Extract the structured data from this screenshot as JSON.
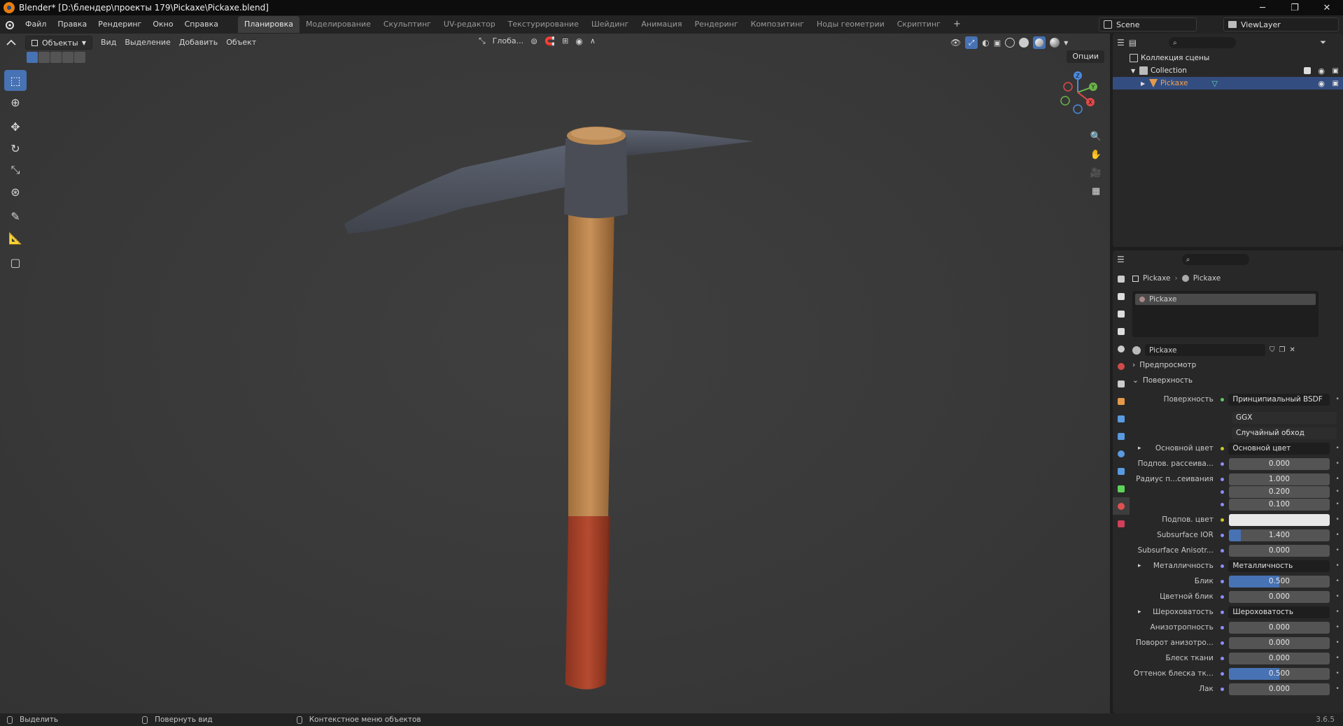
{
  "window": {
    "title": "Blender* [D:\\блендер\\проекты 179\\Pickaxe\\Pickaxe.blend]",
    "minimize": "─",
    "maximize": "❐",
    "close": "✕"
  },
  "menu": [
    "Файл",
    "Правка",
    "Рендеринг",
    "Окно",
    "Справка"
  ],
  "workspaces": [
    "Планировка",
    "Моделирование",
    "Скульптинг",
    "UV-редактор",
    "Текстурирование",
    "Шейдинг",
    "Анимация",
    "Рендеринг",
    "Композитинг",
    "Ноды геометрии",
    "Скриптинг"
  ],
  "active_workspace": "Планировка",
  "add_workspace": "+",
  "scene": {
    "name": "Scene",
    "view_layer": "ViewLayer"
  },
  "viewport": {
    "mode": "Объекты",
    "menus": [
      "Вид",
      "Выделение",
      "Добавить",
      "Объект"
    ],
    "transform_orientation": "Глоба...",
    "options": "Опции"
  },
  "outliner": {
    "root": "Коллекция сцены",
    "collection": "Collection",
    "object": "Pickaxe"
  },
  "properties": {
    "breadcrumb": [
      "Pickaxe",
      "Pickaxe"
    ],
    "material_slot": "Pickaxe",
    "material_name": "Pickaxe",
    "preview_label": "Предпросмотр",
    "surface_panel": "Поверхность",
    "rows": [
      {
        "label": "Поверхность",
        "type": "link",
        "value": "Принципиальный BSDF",
        "socket": "green"
      },
      {
        "label": "",
        "type": "dropdown",
        "value": "GGX"
      },
      {
        "label": "",
        "type": "dropdown",
        "value": "Случайный обход"
      },
      {
        "label": "Основной цвет",
        "type": "link",
        "value": "Основной цвет",
        "socket": "yellow",
        "expand": true
      },
      {
        "label": "Подпов. рассеива...",
        "type": "num",
        "value": "0.000",
        "fill": 0
      },
      {
        "label": "Радиус п...сеивания",
        "type": "num",
        "value": "1.000",
        "fill": 0
      },
      {
        "label": "",
        "type": "num",
        "value": "0.200",
        "fill": 0
      },
      {
        "label": "",
        "type": "num",
        "value": "0.100",
        "fill": 0
      },
      {
        "label": "Подпов. цвет",
        "type": "color",
        "value": "#e8e8e8",
        "socket": "yellow"
      },
      {
        "label": "Subsurface IOR",
        "type": "num",
        "value": "1.400",
        "fill": 0.12
      },
      {
        "label": "Subsurface Anisotr...",
        "type": "num",
        "value": "0.000",
        "fill": 0
      },
      {
        "label": "Металличность",
        "type": "link",
        "value": "Металличность",
        "expand": true
      },
      {
        "label": "Блик",
        "type": "num",
        "value": "0.500",
        "fill": 0.5
      },
      {
        "label": "Цветной блик",
        "type": "num",
        "value": "0.000",
        "fill": 0
      },
      {
        "label": "Шероховатость",
        "type": "link",
        "value": "Шероховатость",
        "expand": true
      },
      {
        "label": "Анизотропность",
        "type": "num",
        "value": "0.000",
        "fill": 0
      },
      {
        "label": "Поворот анизотро...",
        "type": "num",
        "value": "0.000",
        "fill": 0
      },
      {
        "label": "Блеск ткани",
        "type": "num",
        "value": "0.000",
        "fill": 0
      },
      {
        "label": "Оттенок блеска тк...",
        "type": "num",
        "value": "0.500",
        "fill": 0.5
      },
      {
        "label": "Лак",
        "type": "num",
        "value": "0.000",
        "fill": 0
      }
    ]
  },
  "statusbar": {
    "select": "Выделить",
    "rotate": "Повернуть вид",
    "context": "Контекстное меню объектов",
    "version": "3.6.5"
  },
  "colors": {
    "accent": "#4772b3",
    "selection": "#334d80"
  }
}
